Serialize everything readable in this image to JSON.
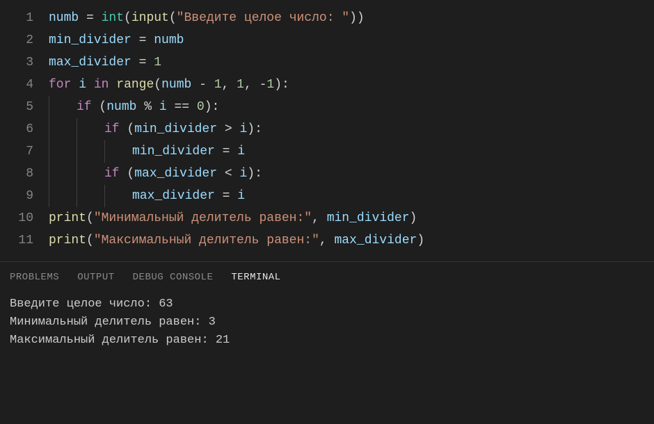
{
  "code": {
    "lines": [
      {
        "n": "1",
        "indent": 0,
        "tokens": [
          {
            "cls": "tok-var",
            "t": "numb"
          },
          {
            "cls": "tok-op",
            "t": " = "
          },
          {
            "cls": "tok-fn",
            "t": "int"
          },
          {
            "cls": "tok-plain",
            "t": "("
          },
          {
            "cls": "tok-call",
            "t": "input"
          },
          {
            "cls": "tok-plain",
            "t": "("
          },
          {
            "cls": "tok-str",
            "t": "\"Введите целое число: \""
          },
          {
            "cls": "tok-plain",
            "t": "))"
          }
        ]
      },
      {
        "n": "2",
        "indent": 0,
        "tokens": [
          {
            "cls": "tok-var",
            "t": "min_divider"
          },
          {
            "cls": "tok-op",
            "t": " = "
          },
          {
            "cls": "tok-var",
            "t": "numb"
          }
        ]
      },
      {
        "n": "3",
        "indent": 0,
        "tokens": [
          {
            "cls": "tok-var",
            "t": "max_divider"
          },
          {
            "cls": "tok-op",
            "t": " = "
          },
          {
            "cls": "tok-num",
            "t": "1"
          }
        ]
      },
      {
        "n": "4",
        "indent": 0,
        "tokens": [
          {
            "cls": "tok-kw",
            "t": "for"
          },
          {
            "cls": "tok-plain",
            "t": " "
          },
          {
            "cls": "tok-var",
            "t": "i"
          },
          {
            "cls": "tok-plain",
            "t": " "
          },
          {
            "cls": "tok-kw",
            "t": "in"
          },
          {
            "cls": "tok-plain",
            "t": " "
          },
          {
            "cls": "tok-call",
            "t": "range"
          },
          {
            "cls": "tok-plain",
            "t": "("
          },
          {
            "cls": "tok-var",
            "t": "numb"
          },
          {
            "cls": "tok-op",
            "t": " - "
          },
          {
            "cls": "tok-num",
            "t": "1"
          },
          {
            "cls": "tok-plain",
            "t": ", "
          },
          {
            "cls": "tok-num",
            "t": "1"
          },
          {
            "cls": "tok-plain",
            "t": ", "
          },
          {
            "cls": "tok-op",
            "t": "-"
          },
          {
            "cls": "tok-num",
            "t": "1"
          },
          {
            "cls": "tok-plain",
            "t": "):"
          }
        ]
      },
      {
        "n": "5",
        "indent": 1,
        "tokens": [
          {
            "cls": "tok-kw",
            "t": "if"
          },
          {
            "cls": "tok-plain",
            "t": " ("
          },
          {
            "cls": "tok-var",
            "t": "numb"
          },
          {
            "cls": "tok-op",
            "t": " % "
          },
          {
            "cls": "tok-var",
            "t": "i"
          },
          {
            "cls": "tok-op",
            "t": " == "
          },
          {
            "cls": "tok-num",
            "t": "0"
          },
          {
            "cls": "tok-plain",
            "t": "):"
          }
        ]
      },
      {
        "n": "6",
        "indent": 2,
        "tokens": [
          {
            "cls": "tok-kw",
            "t": "if"
          },
          {
            "cls": "tok-plain",
            "t": " ("
          },
          {
            "cls": "tok-var",
            "t": "min_divider"
          },
          {
            "cls": "tok-op",
            "t": " > "
          },
          {
            "cls": "tok-var",
            "t": "i"
          },
          {
            "cls": "tok-plain",
            "t": "):"
          }
        ]
      },
      {
        "n": "7",
        "indent": 3,
        "tokens": [
          {
            "cls": "tok-var",
            "t": "min_divider"
          },
          {
            "cls": "tok-op",
            "t": " = "
          },
          {
            "cls": "tok-var",
            "t": "i"
          }
        ]
      },
      {
        "n": "8",
        "indent": 2,
        "tokens": [
          {
            "cls": "tok-kw",
            "t": "if"
          },
          {
            "cls": "tok-plain",
            "t": " ("
          },
          {
            "cls": "tok-var",
            "t": "max_divider"
          },
          {
            "cls": "tok-op",
            "t": " < "
          },
          {
            "cls": "tok-var",
            "t": "i"
          },
          {
            "cls": "tok-plain",
            "t": "):"
          }
        ]
      },
      {
        "n": "9",
        "indent": 3,
        "tokens": [
          {
            "cls": "tok-var",
            "t": "max_divider"
          },
          {
            "cls": "tok-op",
            "t": " = "
          },
          {
            "cls": "tok-var",
            "t": "i"
          }
        ]
      },
      {
        "n": "10",
        "indent": 0,
        "tokens": [
          {
            "cls": "tok-call",
            "t": "print"
          },
          {
            "cls": "tok-plain",
            "t": "("
          },
          {
            "cls": "tok-str",
            "t": "\"Минимальный делитель равен:\""
          },
          {
            "cls": "tok-plain",
            "t": ", "
          },
          {
            "cls": "tok-var",
            "t": "min_divider"
          },
          {
            "cls": "tok-plain",
            "t": ")"
          }
        ]
      },
      {
        "n": "11",
        "indent": 0,
        "tokens": [
          {
            "cls": "tok-call",
            "t": "print"
          },
          {
            "cls": "tok-plain",
            "t": "("
          },
          {
            "cls": "tok-str",
            "t": "\"Максимальный делитель равен:\""
          },
          {
            "cls": "tok-plain",
            "t": ", "
          },
          {
            "cls": "tok-var",
            "t": "max_divider"
          },
          {
            "cls": "tok-plain",
            "t": ")"
          }
        ]
      }
    ]
  },
  "panel": {
    "tabs": {
      "problems": "PROBLEMS",
      "output": "OUTPUT",
      "debug": "DEBUG CONSOLE",
      "terminal": "TERMINAL"
    },
    "terminal_lines": [
      "Введите целое число: 63",
      "Минимальный делитель равен: 3",
      "Максимальный делитель равен: 21"
    ]
  }
}
